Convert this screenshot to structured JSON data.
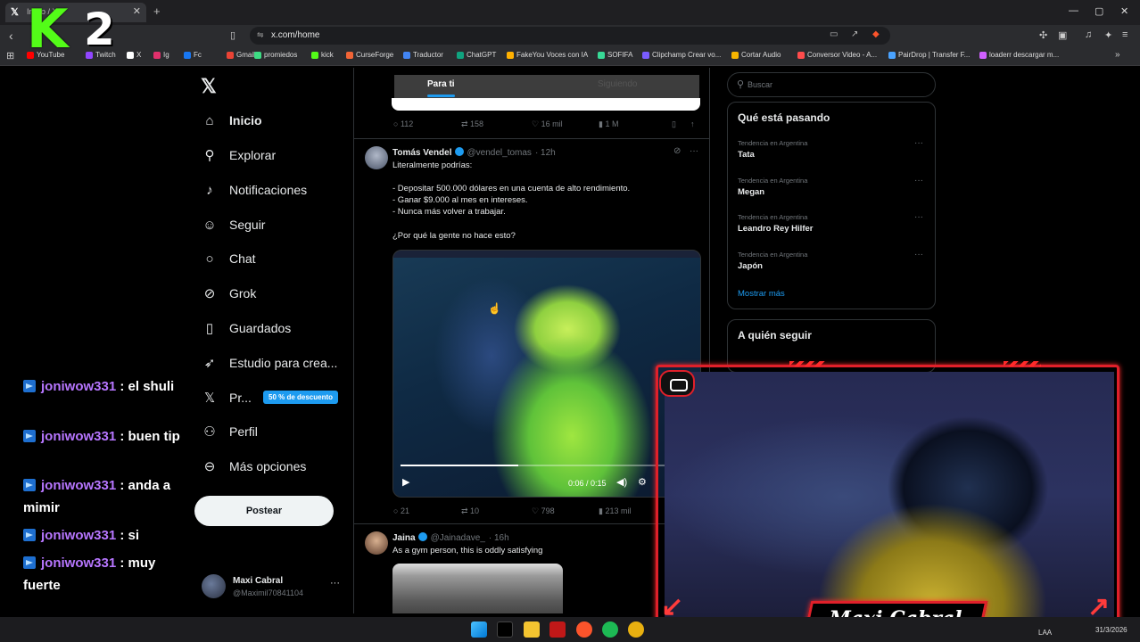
{
  "browser": {
    "tab_title": "Inicio / X",
    "url": "x.com/home",
    "bookmarks": [
      "YouTube",
      "Twitch",
      "X",
      "Ig",
      "Fc",
      "Gmail",
      "promiedos",
      "kick",
      "CurseForge",
      "Traductor",
      "ChatGPT",
      "FakeYou Voces con IA",
      "SOFIFA",
      "Clipchamp Crear vo...",
      "Cortar Audio",
      "Conversor Video - A...",
      "PairDrop | Transfer F...",
      "loaderr descargar m..."
    ],
    "bookmark_colors": [
      "#ff0000",
      "#9146ff",
      "#ffffff",
      "#e1306c",
      "#1877f2",
      "#ea4335",
      "#3ddc84",
      "#53fc18",
      "#f16436",
      "#4285f4",
      "#10a37f",
      "#ffb000",
      "#38d996",
      "#7a5cff",
      "#f7b500",
      "#ff4c4c",
      "#4aa3ff",
      "#d060ff"
    ]
  },
  "overlay": {
    "logo_k": "K",
    "logo_num": "2",
    "streamer_name": "Maxi Cabral"
  },
  "chat": [
    {
      "user": "joniwow331",
      "msg": ": el shuli"
    },
    {
      "user": "joniwow331",
      "msg": ": buen tip"
    },
    {
      "user": "joniwow331",
      "msg": ": anda a mimir"
    },
    {
      "user": "joniwow331",
      "msg": ": si"
    },
    {
      "user": "joniwow331",
      "msg": ": muy fuerte"
    }
  ],
  "nav": {
    "items": [
      {
        "label": "Inicio",
        "icon": "home-icon"
      },
      {
        "label": "Explorar",
        "icon": "search-icon"
      },
      {
        "label": "Notificaciones",
        "icon": "bell-icon"
      },
      {
        "label": "Seguir",
        "icon": "add-user-icon"
      },
      {
        "label": "Chat",
        "icon": "chat-icon"
      },
      {
        "label": "Grok",
        "icon": "grok-icon"
      },
      {
        "label": "Guardados",
        "icon": "bookmark-icon"
      },
      {
        "label": "Estudio para crea...",
        "icon": "rocket-icon"
      },
      {
        "label": "Pr...",
        "icon": "x-icon"
      },
      {
        "label": "Perfil",
        "icon": "person-icon"
      },
      {
        "label": "Más opciones",
        "icon": "more-circle-icon"
      }
    ],
    "premium_badge": "50 % de descuento",
    "post_button": "Postear"
  },
  "account": {
    "name": "Maxi Cabral",
    "handle": "@Maximil70841104"
  },
  "feed": {
    "tabs": [
      "Para ti",
      "Siguiendo"
    ],
    "prev_actions": {
      "replies": "112",
      "reposts": "158",
      "likes": "16 mil",
      "views": "1 M"
    },
    "tweet1": {
      "name": "Tomás Vendel",
      "handle": "@vendel_tomas",
      "time": "· 12h",
      "lines": [
        "Literalmente podrías:",
        "",
        "- Depositar 500.000 dólares en una cuenta de alto rendimiento.",
        "- Ganar $9.000 al mes en intereses.",
        "- Nunca más volver a trabajar.",
        "",
        "¿Por qué la gente no hace esto?"
      ],
      "video_time": "0:06 / 0:15",
      "video_progress": 0.4,
      "actions": {
        "replies": "21",
        "reposts": "10",
        "likes": "798",
        "views": "213 mil"
      }
    },
    "tweet2": {
      "name": "Jaina",
      "handle": "@Jainadave_",
      "time": "· 16h",
      "text": "As a gym person, this is oddly satisfying"
    }
  },
  "sidebar": {
    "search_placeholder": "Buscar",
    "trends_title": "Qué está pasando",
    "trends": [
      {
        "context": "Tendencia en Argentina",
        "name": "Tata"
      },
      {
        "context": "Tendencia en Argentina",
        "name": "Megan"
      },
      {
        "context": "Tendencia en Argentina",
        "name": "Leandro Rey Hilfer"
      },
      {
        "context": "Tendencia en Argentina",
        "name": "Japón"
      }
    ],
    "show_more": "Mostrar más",
    "who_to_follow_title": "A quién seguir"
  },
  "taskbar": {
    "tray_text": "LAA",
    "date": "31/3/2026"
  }
}
